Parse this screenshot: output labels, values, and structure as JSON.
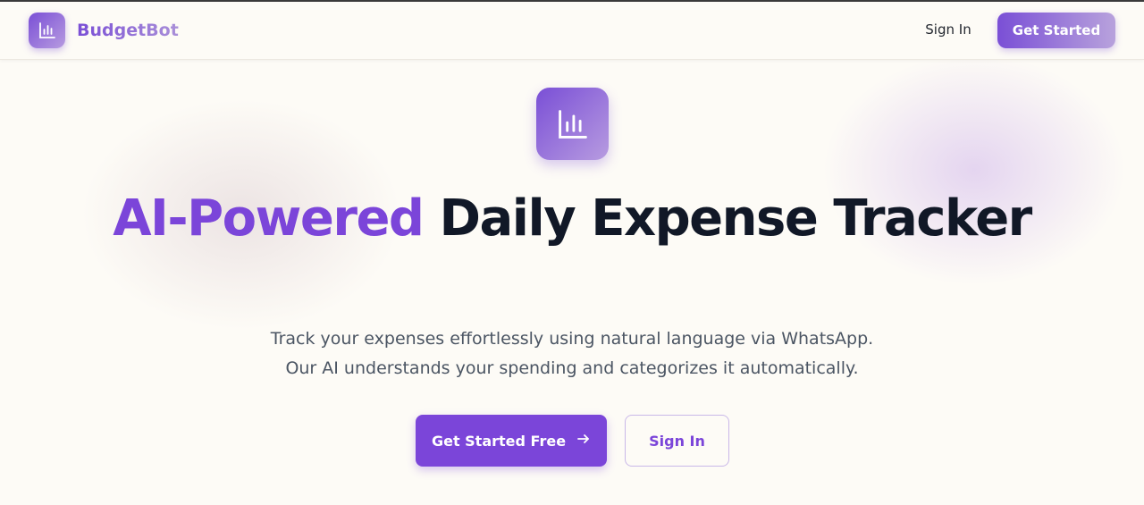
{
  "brand": {
    "name": "BudgetBot",
    "logo_icon": "bar-chart-icon"
  },
  "nav": {
    "signin_label": "Sign In",
    "get_started_label": "Get Started"
  },
  "hero": {
    "icon": "bar-chart-icon",
    "title_accent": "AI-Powered",
    "title_rest": "Daily Expense Tracker",
    "subtitle_line1": "Track your expenses effortlessly using natural language via WhatsApp.",
    "subtitle_line2": "Our AI understands your spending and categorizes it automatically.",
    "cta_primary_label": "Get Started Free",
    "cta_primary_icon": "arrow-right-icon",
    "cta_secondary_label": "Sign In"
  },
  "colors": {
    "accent": "#7b45d9",
    "heading": "#111827",
    "body_text": "#4b5563",
    "background": "#fdfbf6"
  }
}
